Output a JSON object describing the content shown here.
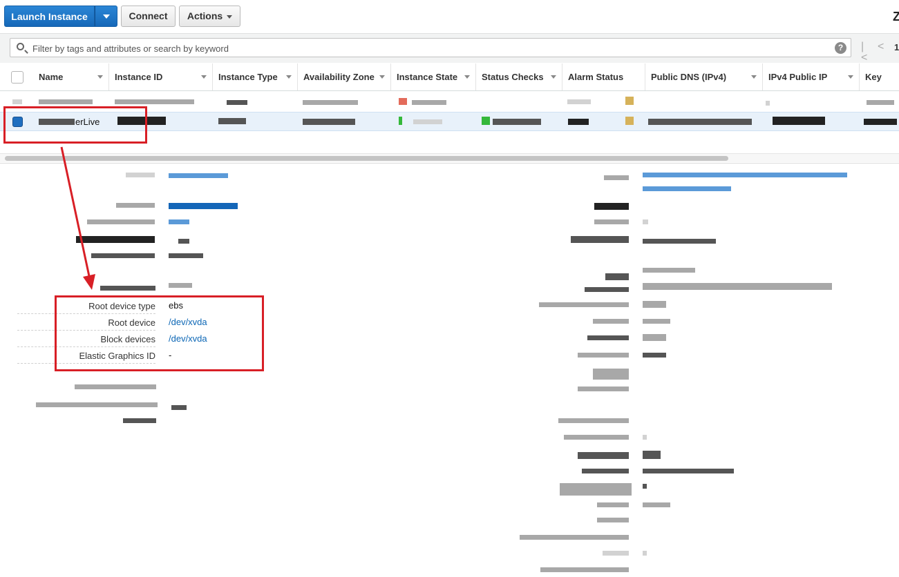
{
  "toolbar": {
    "launch_label": "Launch Instance",
    "connect_label": "Connect",
    "actions_label": "Actions",
    "corner_glyph": "Z"
  },
  "search": {
    "placeholder": "Filter by tags and attributes or search by keyword",
    "help_glyph": "?"
  },
  "pager": {
    "first": "|<",
    "prev": "<",
    "page": "1"
  },
  "table": {
    "columns": [
      "Name",
      "Instance ID",
      "Instance Type",
      "Availability Zone",
      "Instance State",
      "Status Checks",
      "Alarm Status",
      "Public DNS (IPv4)",
      "IPv4 Public IP",
      "Key Nam"
    ],
    "selected_row_name_suffix": "erLive"
  },
  "details": {
    "root_device_type_label": "Root device type",
    "root_device_type_value": "ebs",
    "root_device_label": "Root device",
    "root_device_value": "/dev/xvda",
    "block_devices_label": "Block devices",
    "block_devices_value": "/dev/xvda",
    "elastic_graphics_label": "Elastic Graphics ID",
    "elastic_graphics_value": "-"
  },
  "colors": {
    "primary": "#1668b8",
    "annotation": "#d81f26",
    "link": "#0b66b5",
    "selected_row": "#e8f1fa"
  }
}
